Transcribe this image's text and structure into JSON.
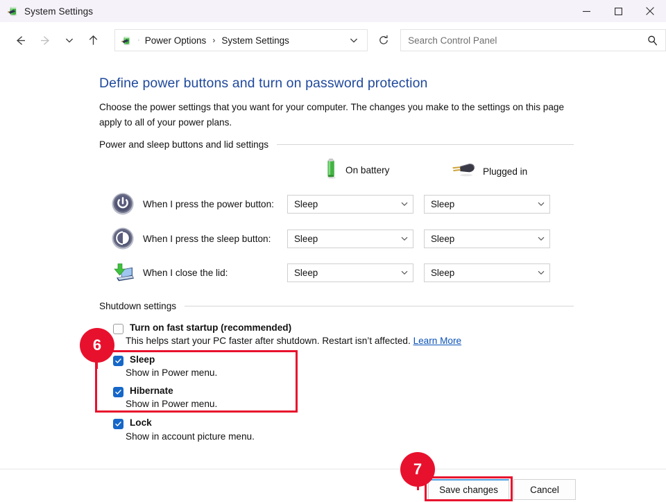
{
  "window": {
    "title": "System Settings",
    "app_icon": "power-options-icon",
    "controls": [
      {
        "name": "minimize",
        "glyph": "minimize-icon"
      },
      {
        "name": "maximize",
        "glyph": "maximize-icon"
      },
      {
        "name": "close",
        "glyph": "close-icon"
      }
    ]
  },
  "nav": {
    "back": "back-arrow-icon",
    "forward": "forward-arrow-icon",
    "recent": "recent-locations-chevron-icon",
    "up": "up-arrow-icon",
    "address_icon": "power-options-icon",
    "breadcrumbs": [
      {
        "label": "Power Options"
      },
      {
        "label": "System Settings"
      }
    ],
    "breadcrumb_separator": "›",
    "dropdown": "address-chevron-down-icon",
    "refresh": "refresh-icon"
  },
  "search": {
    "placeholder": "Search Control Panel",
    "value": "",
    "icon": "search-icon"
  },
  "page": {
    "heading": "Define power buttons and turn on password protection",
    "description": "Choose the power settings that you want for your computer. The changes you make to the settings on this page apply to all of your power plans."
  },
  "power_section": {
    "group_label": "Power and sleep buttons and lid settings",
    "columns": [
      {
        "label": "On battery",
        "icon": "battery-icon"
      },
      {
        "label": "Plugged in",
        "icon": "power-plug-icon"
      }
    ],
    "rows": [
      {
        "icon": "power-button-icon",
        "label": "When I press the power button:",
        "on_battery": "Sleep",
        "plugged_in": "Sleep"
      },
      {
        "icon": "sleep-button-icon",
        "label": "When I press the sleep button:",
        "on_battery": "Sleep",
        "plugged_in": "Sleep"
      },
      {
        "icon": "laptop-lid-icon",
        "label": "When I close the lid:",
        "on_battery": "Sleep",
        "plugged_in": "Sleep"
      }
    ]
  },
  "shutdown_section": {
    "group_label": "Shutdown settings",
    "items": [
      {
        "id": "fast-startup",
        "title": "Turn on fast startup (recommended)",
        "checked": false,
        "description": "This helps start your PC faster after shutdown. Restart isn’t affected.",
        "link": "Learn More"
      },
      {
        "id": "sleep",
        "title": "Sleep",
        "checked": true,
        "description": "Show in Power menu.",
        "link": ""
      },
      {
        "id": "hibernate",
        "title": "Hibernate",
        "checked": true,
        "description": "Show in Power menu.",
        "link": ""
      },
      {
        "id": "lock",
        "title": "Lock",
        "checked": true,
        "description": "Show in account picture menu.",
        "link": ""
      }
    ]
  },
  "footer": {
    "save_label": "Save changes",
    "cancel_label": "Cancel"
  },
  "annotations": {
    "accent_color": "#e8112d",
    "steps": [
      {
        "number": "6",
        "target": "sleep-and-hibernate-checkboxes"
      },
      {
        "number": "7",
        "target": "save-changes-button"
      }
    ]
  }
}
